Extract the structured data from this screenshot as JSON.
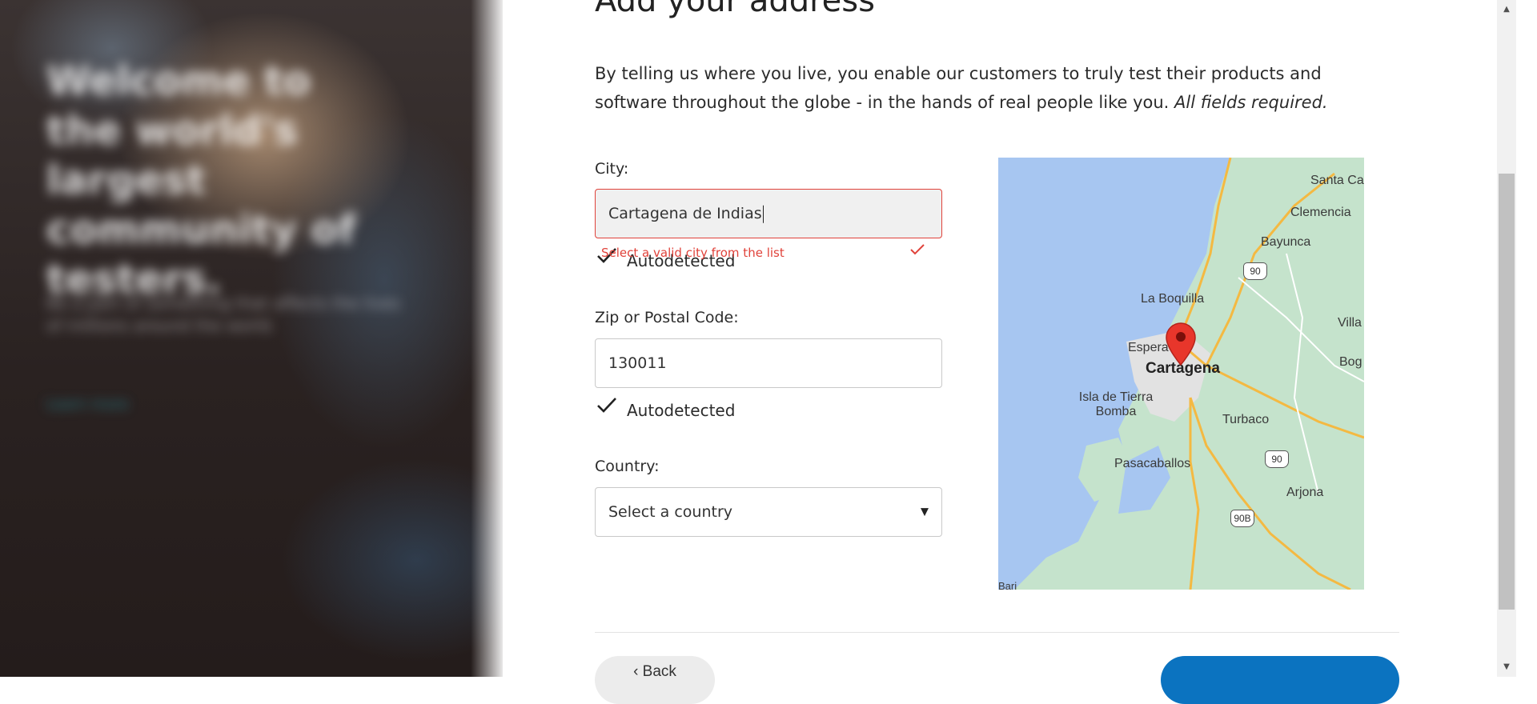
{
  "hero": {
    "title": "Welcome to the world's largest community of testers.",
    "subtitle": "Be a part of something that affects the lives of millions around the world.",
    "link": "Learn more"
  },
  "page": {
    "heading": "Add your address",
    "intro_text": "By telling us where you live, you enable our customers to truly test their products and software throughout the globe - in the hands of real people like you.",
    "intro_emphasis": "All fields required."
  },
  "city": {
    "label": "City:",
    "value": "Cartagena de Indias",
    "error": "Select a valid city from the list",
    "autodetected": "Autodetected"
  },
  "zip": {
    "label": "Zip or Postal Code:",
    "value": "130011",
    "autodetected": "Autodetected"
  },
  "country": {
    "label": "Country:",
    "placeholder": "Select a country"
  },
  "map": {
    "labels": {
      "santa_catalina": "Santa Ca",
      "clemencia": "Clemencia",
      "bayunca": "Bayunca",
      "la_boquilla": "La Boquilla",
      "villa": "Villa",
      "esperanza": "Espera",
      "cartagena": "Cartagena",
      "bog": "Bog",
      "isla": "Isla de Tierra\nBomba",
      "turbaco": "Turbaco",
      "pasacaballos": "Pasacaballos",
      "arjona": "Arjona",
      "bottom": "Bari"
    },
    "shields": {
      "route_90_a": "90",
      "route_90_b": "90",
      "route_90b": "90B"
    },
    "colors": {
      "water": "#a7c6f1",
      "land": "#c5e3cc",
      "road": "#f4b942",
      "pin": "#e8362b"
    }
  },
  "nav": {
    "back_label": "Back"
  },
  "scrollbar": {
    "up": "▲",
    "down": "▼"
  }
}
